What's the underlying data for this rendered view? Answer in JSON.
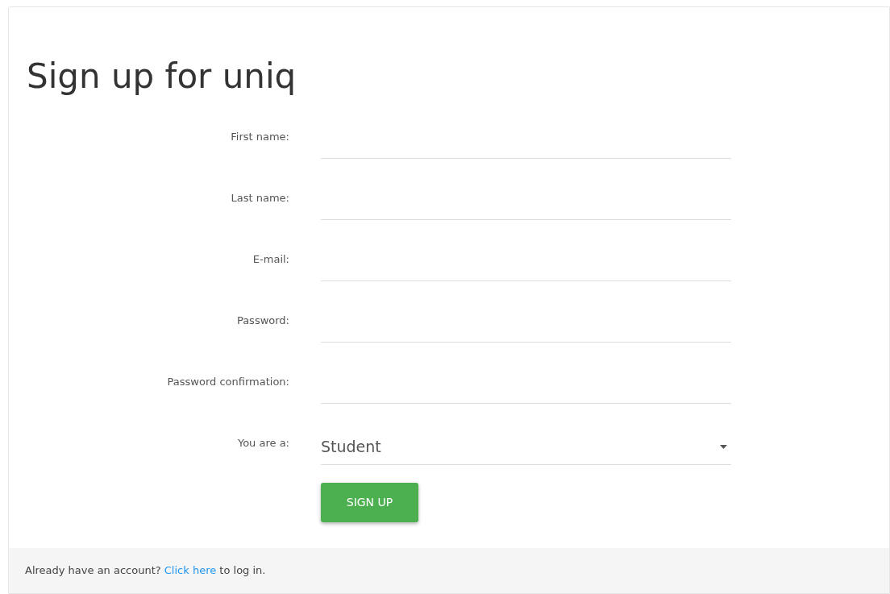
{
  "title": "Sign up for uniq",
  "fields": [
    {
      "kind": "text",
      "label": "First name:"
    },
    {
      "kind": "text",
      "label": "Last name:"
    },
    {
      "kind": "text",
      "label": "E-mail:"
    },
    {
      "kind": "text",
      "label": "Password:"
    },
    {
      "kind": "text",
      "label": "Password confirmation:"
    },
    {
      "kind": "select",
      "label": "You are a:",
      "value": "Student"
    }
  ],
  "submit": "SIGN UP",
  "footer": {
    "before": "Already have an account?",
    "link": "Click here",
    "after": "to log in."
  }
}
